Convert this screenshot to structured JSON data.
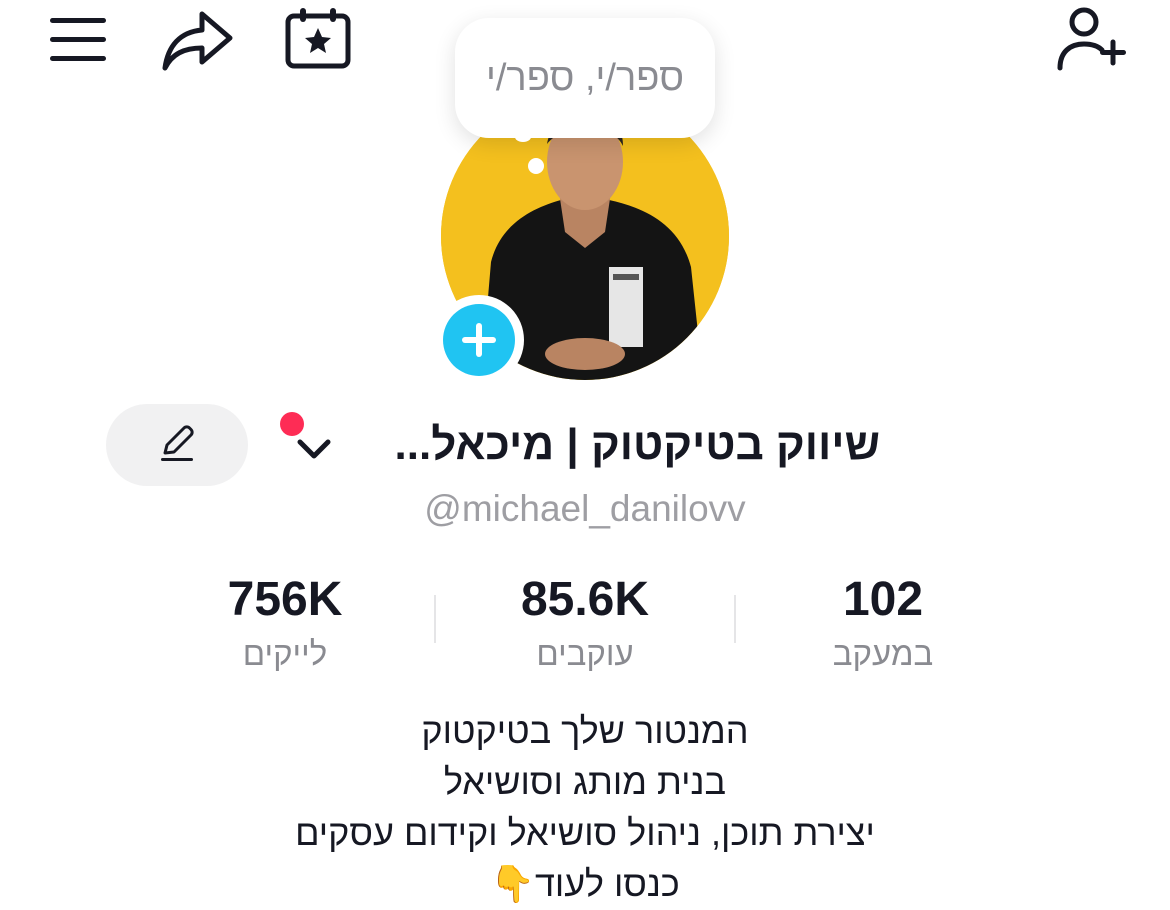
{
  "header": {
    "menu_icon": "hamburger-menu-icon",
    "share_icon": "share-arrow-icon",
    "calendar_icon": "calendar-star-icon",
    "add_friend_icon": "add-person-icon"
  },
  "note_bubble": {
    "text": "ספר/י, ספר/י"
  },
  "profile": {
    "display_name": "שיווק בטיקטוק | מיכאל...",
    "username": "@michael_danilovv",
    "has_notification_dot": true
  },
  "stats": {
    "following": {
      "value": "102",
      "label": "במעקב"
    },
    "followers": {
      "value": "85.6K",
      "label": "עוקבים"
    },
    "likes": {
      "value": "756K",
      "label": "לייקים"
    }
  },
  "bio": {
    "lines": [
      "המנטור שלך בטיקטוק",
      "בנית מותג וסושיאל",
      "יצירת תוכן, ניהול סושיאל וקידום עסקים",
      "כנסו לעוד👇"
    ]
  },
  "colors": {
    "accent_red": "#fe2c55",
    "accent_cyan": "#20c4f2",
    "avatar_bg": "#f4c01e",
    "muted_text": "#8a8b91"
  }
}
